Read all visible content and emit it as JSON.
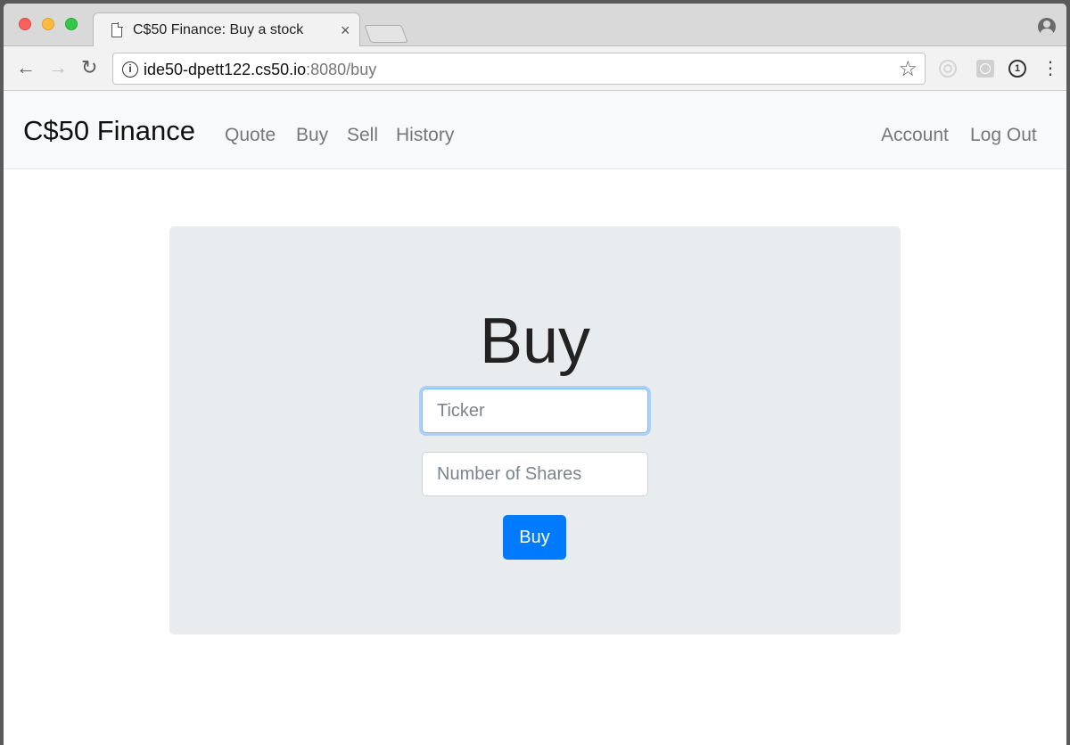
{
  "browser": {
    "tab_title": "C$50 Finance: Buy a stock",
    "tab_close": "×",
    "url_host": "ide50-dpett122.cs50.io",
    "url_rest": ":8080/buy"
  },
  "navbar": {
    "brand": "C$50 Finance",
    "left_links": [
      "Quote",
      "Buy",
      "Sell",
      "History"
    ],
    "right_links": [
      "Account",
      "Log Out"
    ]
  },
  "form": {
    "heading": "Buy",
    "ticker_placeholder": "Ticker",
    "ticker_value": "",
    "shares_placeholder": "Number of Shares",
    "shares_value": "",
    "submit_label": "Buy"
  },
  "colors": {
    "primary": "#007bff",
    "jumbotron": "#e9ecef",
    "navbar": "#f8f9fa"
  }
}
